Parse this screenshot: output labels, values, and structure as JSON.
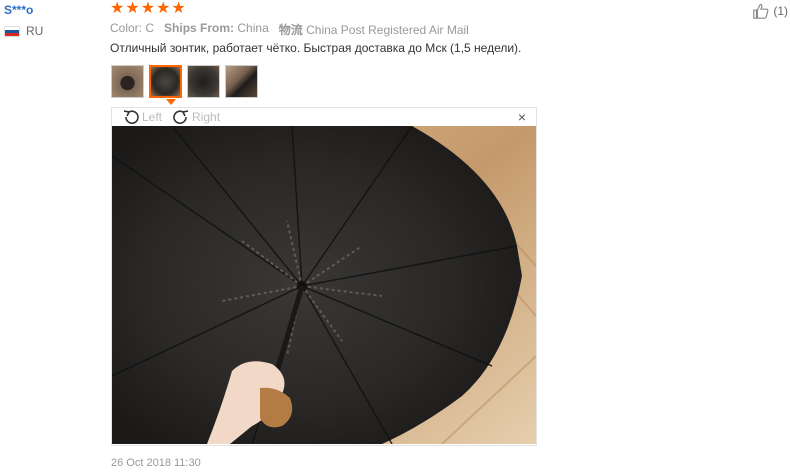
{
  "user": {
    "name": "S***o",
    "country": "RU"
  },
  "rating": {
    "stars": 5
  },
  "helpful": {
    "count": "(1)"
  },
  "meta": {
    "color_label": "Color:",
    "color_value": "C",
    "ships_label": "Ships From:",
    "ships_value": "China",
    "logistics_label": "物流",
    "logistics_value": "China Post Registered Air Mail"
  },
  "review": {
    "text": "Отличный зонтик, работает чётко. Быстрая доставка до Мск (1,5 недели)."
  },
  "thumbnails": {
    "count": 4,
    "active_index": 1
  },
  "viewer": {
    "rotate_left_label": "Left",
    "rotate_right_label": "Right",
    "close_label": "×"
  },
  "date": "26 Oct 2018 11:30",
  "colors": {
    "star": "#ff6600",
    "username": "#2a6fc9",
    "accent": "#ff6600"
  }
}
